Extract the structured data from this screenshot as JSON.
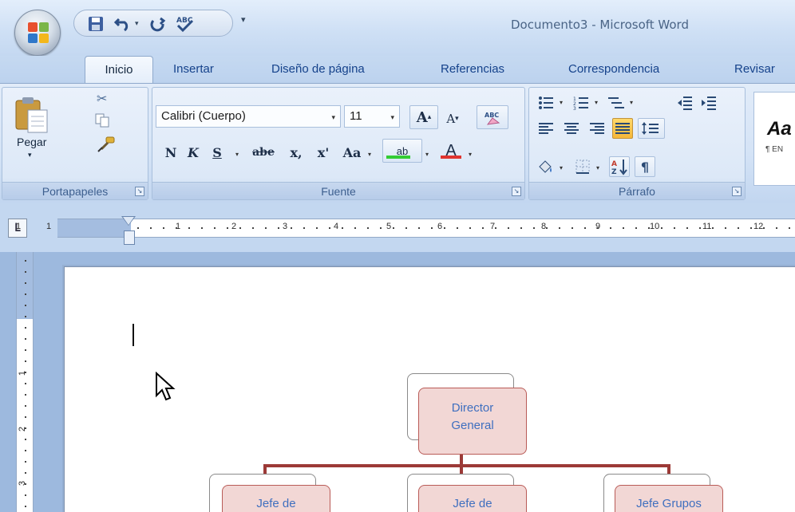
{
  "window": {
    "title": "Documento3 - Microsoft Word"
  },
  "quick_access": {
    "items": [
      "save-icon",
      "undo-icon",
      "redo-icon",
      "spelling-icon",
      "customize-icon"
    ]
  },
  "tabs": [
    {
      "label": "Inicio",
      "active": true
    },
    {
      "label": "Insertar"
    },
    {
      "label": "Diseño de página"
    },
    {
      "label": "Referencias"
    },
    {
      "label": "Correspondencia"
    },
    {
      "label": "Revisar"
    }
  ],
  "ribbon": {
    "clipboard": {
      "label": "Portapapeles",
      "paste_label": "Pegar"
    },
    "font": {
      "label": "Fuente",
      "font_name": "Calibri (Cuerpo)",
      "font_size": "11",
      "grow_label": "A",
      "shrink_label": "A",
      "bold_label": "N",
      "italic_label": "K",
      "underline_label": "S",
      "strike_label": "abe",
      "subscript_label": "x,",
      "superscript_label": "x'",
      "case_label": "Aa",
      "highlight_label": "ab",
      "color_label": "A",
      "highlight_color": "#33cc33",
      "font_color": "#e0342f"
    },
    "paragraph": {
      "label": "Párrafo"
    },
    "styles": {
      "sample": "Aa",
      "name": "¶ EN"
    }
  },
  "ruler": {
    "tab_selector": "L",
    "numbers": [
      "1",
      "1",
      "1",
      "2",
      "3",
      "4",
      "5",
      "6",
      "7",
      "8",
      "9",
      "10",
      "11",
      "12"
    ],
    "vertical_numbers": [
      "1",
      "2",
      "3"
    ]
  },
  "org_chart": {
    "top": "Director General",
    "children": [
      "Jefe de",
      "Jefe de",
      "Jefe Grupos"
    ],
    "connector_color": "#9c3a37",
    "box_fill": "#f2d7d5",
    "text_color": "#3f6fbf"
  }
}
